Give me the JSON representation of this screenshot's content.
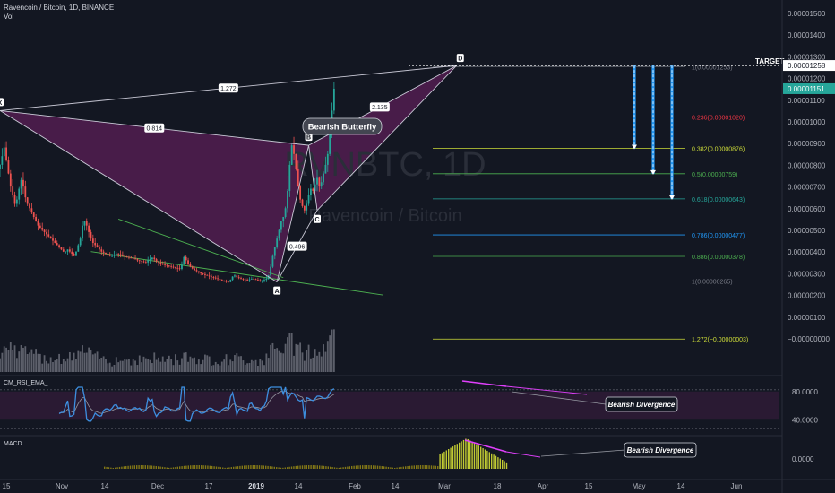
{
  "header": {
    "symbol_line": "Ravencoin / Bitcoin, 1D, BINANCE",
    "volume_label": "Vol"
  },
  "watermark": {
    "ticker": "RVNBTC, 1D",
    "name": "Ravencoin / Bitcoin"
  },
  "colors": {
    "background": "#131722",
    "up": "#26a69a",
    "down": "#ef5350",
    "pattern_fill": "#5b1f57",
    "rsi_line": "#3d8fe0",
    "divergence": "#e040fb",
    "target_badge": "#ffffff",
    "last_price_badge": "#26a69a"
  },
  "chart_data": [
    {
      "type": "line",
      "title": "",
      "pair_label": "Ravencoin / Bitcoin, 1D, BINANCE",
      "xlabel": "",
      "ylabel": "",
      "y_scale": "linear",
      "ylim": [
        -2e-07,
        1.6e-06
      ],
      "grid": false,
      "x_ticks": [
        "15",
        "Nov",
        "14",
        "Dec",
        "17",
        "2019",
        "14",
        "Feb",
        "14",
        "Mar",
        "18",
        "Apr",
        "15",
        "May",
        "14",
        "Jun"
      ],
      "y_ticks": [
        "0.00001500",
        "0.00001400",
        "0.00001300",
        "0.00001200",
        "0.00001100",
        "0.00001000",
        "0.00000900",
        "0.00000800",
        "0.00000700",
        "0.00000600",
        "0.00000500",
        "0.00000400",
        "0.00000300",
        "0.00000200",
        "0.00000100",
        "−0.00000000"
      ],
      "last_price": "0.00001151",
      "target_price": "0.00001258",
      "target_label": "TARGET",
      "pattern": {
        "name": "Bearish Butterfly",
        "points": [
          {
            "label": "X",
            "date": "2018-10-15",
            "price": 1.05e-05
          },
          {
            "label": "A",
            "date": "2019-02-23",
            "price": 2.6e-06
          },
          {
            "label": "B",
            "date": "2019-03-10",
            "price": 8.9e-06
          },
          {
            "label": "C",
            "date": "2019-03-14",
            "price": 5.9e-06
          },
          {
            "label": "D",
            "date": "2019-05-19",
            "price": 1.258e-05
          }
        ],
        "ratios": [
          {
            "value": "1.272",
            "between": "X-D"
          },
          {
            "value": "0.814",
            "between": "X-B"
          },
          {
            "value": "0.496",
            "between": "A-C"
          },
          {
            "value": "2.135",
            "between": "B-D"
          }
        ]
      },
      "fib_levels": [
        {
          "label": "1(0.00001253)",
          "price": 1.253e-05,
          "color": "#787b86"
        },
        {
          "label": "0.236(0.00001020)",
          "price": 1.02e-05,
          "color": "#f23645"
        },
        {
          "label": "0.382(0.00000876)",
          "price": 8.76e-06,
          "color": "#cddc39"
        },
        {
          "label": "0.5(0.00000759)",
          "price": 7.59e-06,
          "color": "#4caf50"
        },
        {
          "label": "0.618(0.00000643)",
          "price": 6.43e-06,
          "color": "#26a69a"
        },
        {
          "label": "0.786(0.00000477)",
          "price": 4.77e-06,
          "color": "#2196f3"
        },
        {
          "label": "0.886(0.00000378)",
          "price": 3.78e-06,
          "color": "#4caf50"
        },
        {
          "label": "1(0.00000265)",
          "price": 2.65e-06,
          "color": "#787b86"
        },
        {
          "label": "1.272(−0.00000003)",
          "price": -3e-08,
          "color": "#cddc39"
        }
      ],
      "targets": [
        8.76e-06,
        7.59e-06,
        6.43e-06
      ],
      "wedge": {
        "upper": [
          {
            "date": "2018-12-10",
            "price": 5.5e-06
          },
          {
            "date": "2019-02-26",
            "price": 2.8e-06
          }
        ],
        "lower": [
          {
            "date": "2018-11-27",
            "price": 4e-06
          },
          {
            "date": "2019-04-14",
            "price": 2e-06
          }
        ]
      },
      "series": [
        {
          "name": "",
          "kind": "candles",
          "start_date": "2018-10-01",
          "closes": [
            2.7e-06,
            2.65e-06,
            3.3e-06,
            4e-06,
            4.8e-06,
            5.6e-06,
            6.2e-06,
            7e-06,
            7.8e-06,
            8.5e-06,
            8.9e-06,
            8.6e-06,
            8.2e-06,
            7.8e-06,
            8e-06,
            8.4e-06,
            8.8e-06,
            8.2e-06,
            7.6e-06,
            7e-06,
            6.6e-06,
            6.2e-06,
            6.4e-06,
            6.9e-06,
            7.3e-06,
            7e-06,
            6.5e-06,
            6.2e-06,
            6e-06,
            5.8e-06,
            5.6e-06,
            5.4e-06,
            5.2e-06,
            5.1e-06,
            5e-06,
            4.9e-06,
            4.8e-06,
            4.7e-06,
            4.6e-06,
            4.5e-06,
            4.4e-06,
            4.3e-06,
            4.2e-06,
            4.1e-06,
            4e-06,
            4e-06,
            4.1e-06,
            4e-06,
            3.9e-06,
            3.8e-06,
            4e-06,
            4.3e-06,
            4.6e-06,
            5.2e-06,
            5.4e-06,
            5.2e-06,
            4.9e-06,
            4.6e-06,
            4.4e-06,
            4.3e-06,
            4.2e-06,
            4.1e-06,
            4e-06,
            3.95e-06,
            3.9e-06,
            3.85e-06,
            3.8e-06,
            3.8e-06,
            3.85e-06,
            3.9e-06,
            3.88e-06,
            3.85e-06,
            3.8e-06,
            3.78e-06,
            3.75e-06,
            3.72e-06,
            3.7e-06,
            3.68e-06,
            3.65e-06,
            3.6e-06,
            3.58e-06,
            3.55e-06,
            3.52e-06,
            3.5e-06,
            3.6e-06,
            3.65e-06,
            3.72e-06,
            3.65e-06,
            3.55e-06,
            3.5e-06,
            3.45e-06,
            3.4e-06,
            3.38e-06,
            3.35e-06,
            3.33e-06,
            3.3e-06,
            3.28e-06,
            3.25e-06,
            3.23e-06,
            3.2e-06,
            3.4e-06,
            3.75e-06,
            3.6e-06,
            3.45e-06,
            3.3e-06,
            3.22e-06,
            3.15e-06,
            3.1e-06,
            3.05e-06,
            3e-06,
            2.96e-06,
            2.92e-06,
            2.89e-06,
            2.86e-06,
            2.83e-06,
            2.8e-06,
            2.77e-06,
            2.74e-06,
            2.7e-06,
            2.67e-06,
            2.64e-06,
            2.62e-06,
            2.6e-06,
            2.7e-06,
            2.85e-06,
            2.9e-06,
            2.82e-06,
            2.78e-06,
            2.75e-06,
            2.72e-06,
            2.7e-06,
            2.68e-06,
            2.72e-06,
            2.75e-06,
            2.73e-06,
            2.7e-06,
            2.68e-06,
            2.66e-06,
            2.68e-06,
            2.7e-06,
            2.75e-06,
            2.9e-06,
            3.3e-06,
            3.8e-06,
            4.2e-06,
            4.6e-06,
            5e-06,
            5.4e-06,
            5.6e-06,
            6e-06,
            6.8e-06,
            8e-06,
            8.9e-06,
            8.5e-06,
            7.8e-06,
            7e-06,
            6.4e-06,
            6.1e-06,
            5.9e-06,
            6.2e-06,
            6.6e-06,
            6.9e-06,
            6.8e-06,
            7.1e-06,
            7.4e-06,
            7e-06,
            7.2e-06,
            7.6e-06,
            8e-06,
            8.5e-06,
            9.5e-06,
            1.05e-05,
            1.151e-05
          ]
        },
        {
          "name": "CM_RSI_EMA_",
          "kind": "oscillator",
          "ylim": [
            20,
            100
          ],
          "y_ticks": [
            "80.0000",
            "40.0000"
          ]
        },
        {
          "name": "MACD",
          "kind": "histogram",
          "y_ticks": [
            "0.0000"
          ]
        }
      ],
      "annotations": [
        "Bearish Divergence",
        "Bearish Divergence"
      ]
    }
  ]
}
